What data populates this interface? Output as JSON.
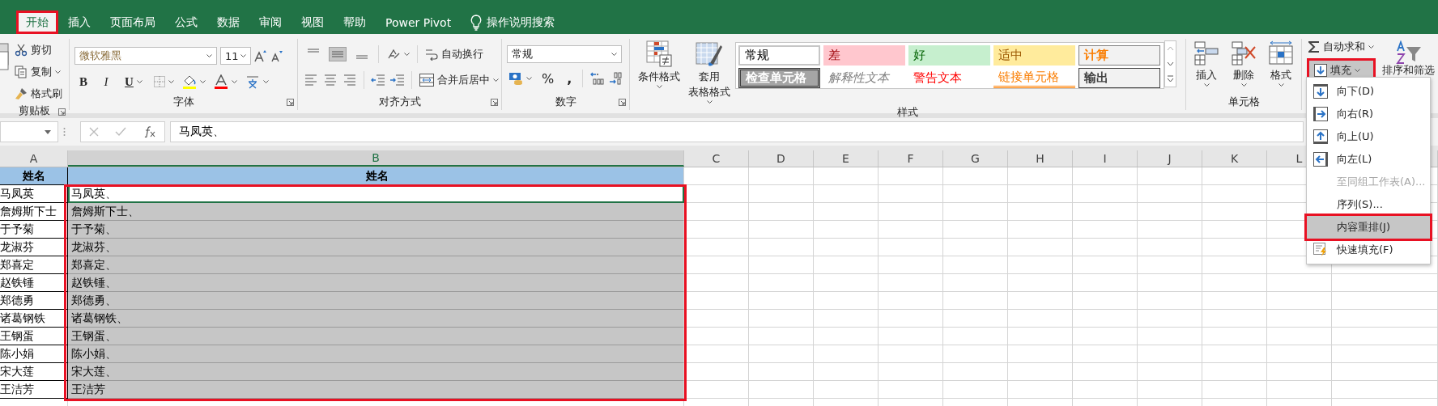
{
  "tabs": [
    {
      "label": "开始",
      "selected": true,
      "highlighted": true
    },
    {
      "label": "插入",
      "selected": false,
      "highlighted": false
    },
    {
      "label": "页面布局",
      "selected": false,
      "highlighted": false
    },
    {
      "label": "公式",
      "selected": false,
      "highlighted": false
    },
    {
      "label": "数据",
      "selected": false,
      "highlighted": false
    },
    {
      "label": "审阅",
      "selected": false,
      "highlighted": false
    },
    {
      "label": "视图",
      "selected": false,
      "highlighted": false
    },
    {
      "label": "帮助",
      "selected": false,
      "highlighted": false
    },
    {
      "label": "Power Pivot",
      "selected": false,
      "highlighted": false
    }
  ],
  "tell_me": "操作说明搜索",
  "ribbon": {
    "clipboard": {
      "label": "剪贴板",
      "commands": [
        "剪切",
        "复制",
        "格式刷"
      ]
    },
    "font": {
      "label": "字体",
      "font_name": "微软雅黑",
      "font_size": "11",
      "style_buttons": [
        "B",
        "I",
        "U"
      ]
    },
    "alignment": {
      "label": "对齐方式",
      "vertical_align": [
        {
          "selected": false
        },
        {
          "selected": true
        },
        {
          "selected": false
        }
      ],
      "wrap_text": "自动换行",
      "merge": "合并后居中"
    },
    "number": {
      "label": "数字",
      "format": "常规",
      "percent": "%",
      "comma": ","
    },
    "styles": {
      "label": "样式",
      "conditional_formatting": "条件格式",
      "format_as_table": [
        "套用",
        "表格格式"
      ],
      "cell_styles": [
        {
          "label": "常规",
          "kind": "normal"
        },
        {
          "label": "差",
          "kind": "bad"
        },
        {
          "label": "好",
          "kind": "good"
        },
        {
          "label": "适中",
          "kind": "neutral"
        },
        {
          "label": "计算",
          "kind": "calculation"
        },
        {
          "label": "检查单元格",
          "kind": "check"
        },
        {
          "label": "解释性文本",
          "kind": "explanatory"
        },
        {
          "label": "警告文本",
          "kind": "warning"
        },
        {
          "label": "链接单元格",
          "kind": "linked"
        },
        {
          "label": "输出",
          "kind": "output"
        }
      ]
    },
    "cells": {
      "label": "单元格",
      "commands": [
        "插入",
        "删除",
        "格式"
      ]
    },
    "editing": {
      "autosum": "自动求和",
      "fill": {
        "label": "填充",
        "highlighted": true,
        "expanded": true
      },
      "sort_filter": "排序和筛选"
    }
  },
  "formula_bar": {
    "value": "马凤英、"
  },
  "sheet": {
    "columns": [
      {
        "label": "A",
        "selected": false
      },
      {
        "label": "B",
        "selected": true
      },
      {
        "label": "C",
        "selected": false
      },
      {
        "label": "D",
        "selected": false
      },
      {
        "label": "E",
        "selected": false
      },
      {
        "label": "F",
        "selected": false
      },
      {
        "label": "G",
        "selected": false
      },
      {
        "label": "H",
        "selected": false
      },
      {
        "label": "I",
        "selected": false
      },
      {
        "label": "J",
        "selected": false
      },
      {
        "label": "K",
        "selected": false
      },
      {
        "label": "L",
        "selected": false
      }
    ],
    "header_row": [
      "姓名",
      "姓名"
    ],
    "selection_highlighted": true,
    "rows": [
      {
        "name": "马凤英",
        "value": "马凤英、",
        "selected": true,
        "active": true
      },
      {
        "name": "詹姆斯下士",
        "value": "詹姆斯下士、",
        "selected": true,
        "active": false
      },
      {
        "name": "于予菊",
        "value": "于予菊、",
        "selected": true,
        "active": false
      },
      {
        "name": "龙淑芬",
        "value": "龙淑芬、",
        "selected": true,
        "active": false
      },
      {
        "name": "郑喜定",
        "value": "郑喜定、",
        "selected": true,
        "active": false
      },
      {
        "name": "赵铁锤",
        "value": "赵铁锤、",
        "selected": true,
        "active": false
      },
      {
        "name": "郑德勇",
        "value": "郑德勇、",
        "selected": true,
        "active": false
      },
      {
        "name": "诸葛钢铁",
        "value": "诸葛钢铁、",
        "selected": true,
        "active": false
      },
      {
        "name": "王钢蛋",
        "value": "王钢蛋、",
        "selected": true,
        "active": false
      },
      {
        "name": "陈小娟",
        "value": "陈小娟、",
        "selected": true,
        "active": false
      },
      {
        "name": "宋大莲",
        "value": "宋大莲、",
        "selected": true,
        "active": false
      },
      {
        "name": "王洁芳",
        "value": "王洁芳",
        "selected": true,
        "active": false
      }
    ]
  },
  "fill_menu": {
    "items": [
      {
        "label": "向下(D)",
        "kind": "down",
        "disabled": false,
        "selected": false,
        "highlighted": false
      },
      {
        "label": "向右(R)",
        "kind": "right",
        "disabled": false,
        "selected": false,
        "highlighted": false
      },
      {
        "label": "向上(U)",
        "kind": "up",
        "disabled": false,
        "selected": false,
        "highlighted": false
      },
      {
        "label": "向左(L)",
        "kind": "left",
        "disabled": false,
        "selected": false,
        "highlighted": false
      },
      {
        "label": "至同组工作表(A)...",
        "kind": "plain",
        "disabled": true,
        "selected": false,
        "highlighted": false
      },
      {
        "label": "序列(S)...",
        "kind": "plain",
        "disabled": false,
        "selected": false,
        "highlighted": false
      },
      {
        "label": "内容重排(J)",
        "kind": "plain",
        "disabled": false,
        "selected": true,
        "highlighted": true
      },
      {
        "label": "快速填充(F)",
        "kind": "flash",
        "disabled": false,
        "selected": false,
        "highlighted": false
      }
    ]
  }
}
